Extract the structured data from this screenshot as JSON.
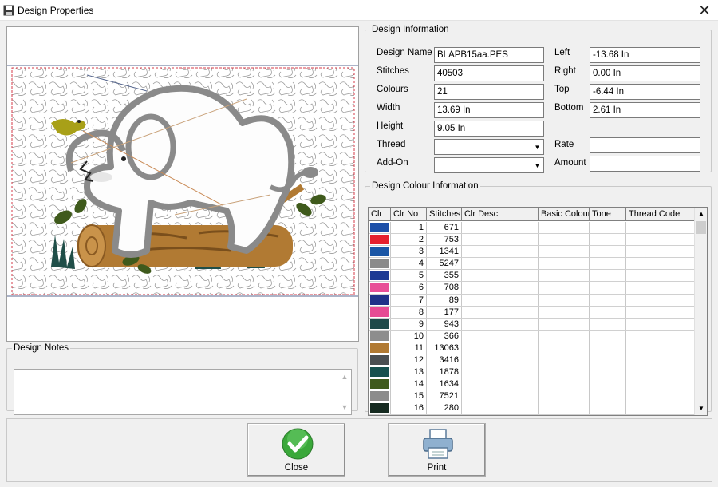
{
  "window": {
    "title": "Design Properties",
    "icon": "save-disk-icon"
  },
  "notes": {
    "legend": "Design Notes",
    "value": ""
  },
  "info": {
    "legend": "Design Information",
    "design_name_label": "Design Name",
    "design_name": "BLAPB15aa.PES",
    "stitches_label": "Stitches",
    "stitches": "40503",
    "colours_label": "Colours",
    "colours": "21",
    "width_label": "Width",
    "width": "13.69 In",
    "height_label": "Height",
    "height": "9.05 In",
    "thread_label": "Thread",
    "thread": "",
    "addon_label": "Add-On",
    "addon": "",
    "left_label": "Left",
    "left": "-13.68 In",
    "right_label": "Right",
    "right": "0.00 In",
    "top_label": "Top",
    "top": "-6.44 In",
    "bottom_label": "Bottom",
    "bottom": "2.61 In",
    "rate_label": "Rate",
    "rate": "",
    "amount_label": "Amount",
    "amount": ""
  },
  "colour_info": {
    "legend": "Design Colour Information",
    "columns": [
      "Clr",
      "Clr No",
      "Stitches",
      "Clr Desc",
      "Basic Colour",
      "Tone",
      "Thread Code"
    ],
    "rows": [
      {
        "color": "#1c4fa8",
        "no": "1",
        "stitches": "671"
      },
      {
        "color": "#e5202e",
        "no": "2",
        "stitches": "753"
      },
      {
        "color": "#1a56a6",
        "no": "3",
        "stitches": "1341"
      },
      {
        "color": "#8a8a8a",
        "no": "4",
        "stitches": "5247"
      },
      {
        "color": "#1c3a94",
        "no": "5",
        "stitches": "355"
      },
      {
        "color": "#e84f97",
        "no": "6",
        "stitches": "708"
      },
      {
        "color": "#1f3288",
        "no": "7",
        "stitches": "89"
      },
      {
        "color": "#e64b94",
        "no": "8",
        "stitches": "177"
      },
      {
        "color": "#1e4a4a",
        "no": "9",
        "stitches": "943"
      },
      {
        "color": "#8d8d8d",
        "no": "10",
        "stitches": "366"
      },
      {
        "color": "#b17a33",
        "no": "11",
        "stitches": "13063"
      },
      {
        "color": "#4b4f52",
        "no": "12",
        "stitches": "3416"
      },
      {
        "color": "#17504e",
        "no": "13",
        "stitches": "1878"
      },
      {
        "color": "#3f5a1c",
        "no": "14",
        "stitches": "1634"
      },
      {
        "color": "#8c8c8c",
        "no": "15",
        "stitches": "7521"
      },
      {
        "color": "#152a20",
        "no": "16",
        "stitches": "280"
      }
    ]
  },
  "buttons": {
    "close_label": "Close",
    "close_icon": "green-check-icon",
    "print_label": "Print",
    "print_icon": "printer-icon"
  }
}
